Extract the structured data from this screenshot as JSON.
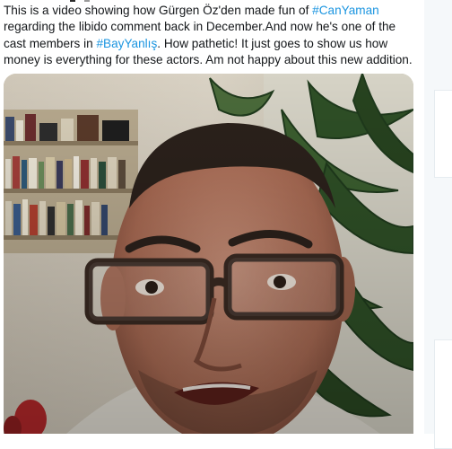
{
  "tweet": {
    "lines": [
      [
        {
          "text": "This is a video showing how Gürgen Öz'den made fun of "
        },
        {
          "text": "#CanYaman",
          "hashtag": true
        }
      ],
      [
        {
          "text": "regarding the libido comment back in December.And now he's one of the"
        }
      ],
      [
        {
          "text": "cast members in "
        },
        {
          "text": "#BayYanlış",
          "hashtag": true
        },
        {
          "text": ". How pathetic! It just goes to show us how"
        }
      ],
      [
        {
          "text": "money is everything for these actors. Am not happy about this new addition."
        }
      ]
    ]
  },
  "media": {
    "kind": "video-still",
    "description_icon": "video-frame"
  },
  "colors": {
    "text": "#14171a",
    "hashtag": "#1b95e0",
    "rail": "#f5f8fa",
    "border": "#e6ecf0"
  }
}
